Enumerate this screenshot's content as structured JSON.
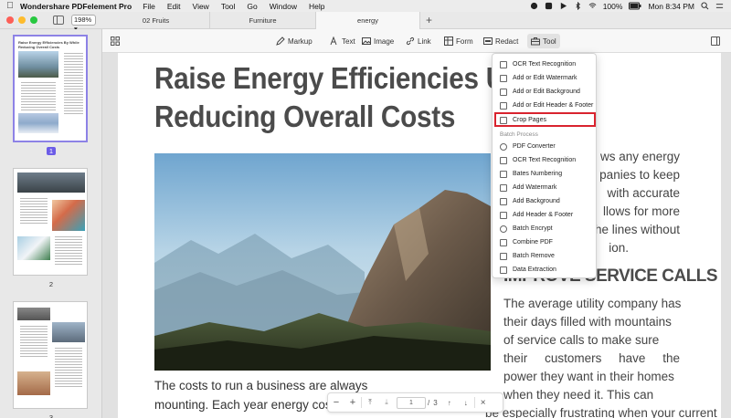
{
  "menubar": {
    "app_name": "Wondershare PDFelement Pro",
    "items": [
      "File",
      "Edit",
      "View",
      "Tool",
      "Go",
      "Window",
      "Help"
    ],
    "battery": "100%",
    "clock": "Mon 8:34 PM"
  },
  "tabs": {
    "zoom": "198%",
    "items": [
      "02 Fruits",
      "Furniture",
      "energy"
    ],
    "add": "+"
  },
  "toolbar": {
    "markup": "Markup",
    "text": "Text",
    "image": "Image",
    "link": "Link",
    "form": "Form",
    "redact": "Redact",
    "tool": "Tool"
  },
  "thumbnails": {
    "pages": [
      "1",
      "2",
      "3"
    ],
    "page1_title": "Raise Energy Efficiencies By While Reducing Overall Costs"
  },
  "document": {
    "title_line1": "Raise Energy Efficiencies Up",
    "title_line2": "Reducing Overall Costs",
    "left_body": [
      "The costs to run a business are always",
      "mounting. Each year energy cos"
    ],
    "right_fragments": [
      "ws any energy",
      "panies to keep",
      "with accurate",
      "llows for more",
      "the lines without",
      "ion."
    ],
    "heading2": "IMPROVE SERVICE CALLS",
    "right_para": [
      [
        "The average utility company has"
      ],
      [
        "their days filled with mountains"
      ],
      [
        "of service calls to make sure"
      ],
      [
        "their",
        "customers",
        "have",
        "the"
      ],
      [
        "power they want in their homes"
      ],
      [
        "when they need it. This can"
      ],
      [
        "be especially frustrating when your current"
      ]
    ]
  },
  "pagenav": {
    "zoom_out": "−",
    "zoom_in": "+",
    "current": "1",
    "separator": "/",
    "total": "3",
    "close": "×"
  },
  "dropdown": {
    "items_top": [
      "OCR Text Recognition",
      "Add or Edit Watermark",
      "Add or Edit Background",
      "Add or Edit Header & Footer",
      "Crop Pages"
    ],
    "section": "Batch Process",
    "items_batch": [
      "PDF Converter",
      "OCR Text Recognition",
      "Bates Numbering",
      "Add Watermark",
      "Add Background",
      "Add Header & Footer",
      "Batch Encrypt",
      "Combine PDF",
      "Batch Remove",
      "Data Extraction"
    ]
  },
  "colors": {
    "accent": "#6c5ce7",
    "highlight_border": "#d9232e"
  }
}
